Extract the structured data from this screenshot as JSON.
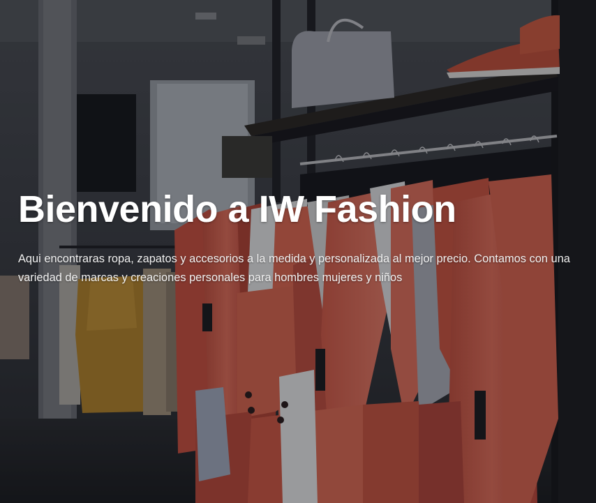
{
  "hero": {
    "title": "Bienvenido a IW Fashion",
    "description": "Aqui encontraras ropa, zapatos y accesorios a la medida y personalizada al mejor precio. Contamos con una variedad de marcas y creaciones personales para hombres mujeres y niños"
  },
  "colors": {
    "overlay": "#0a0c12",
    "title_text": "#ffffff",
    "garment_coral": "#e8664f",
    "garment_mustard": "#b8862a"
  }
}
